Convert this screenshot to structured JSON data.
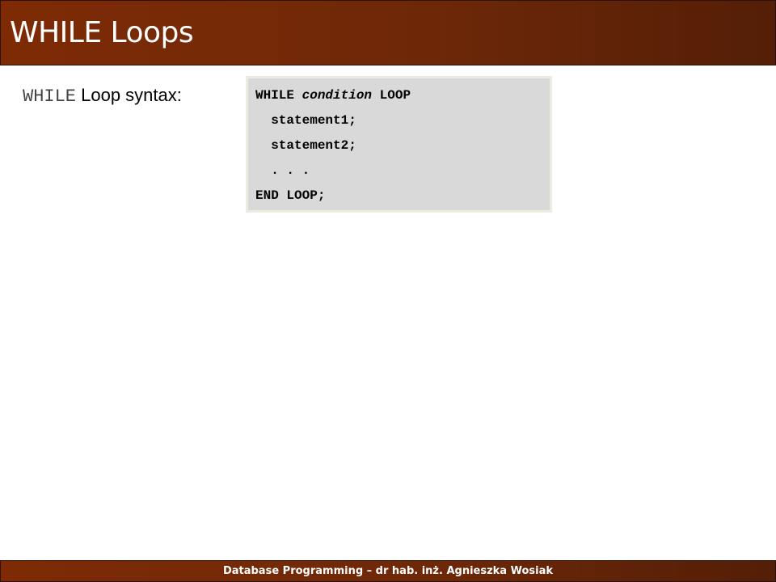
{
  "slide": {
    "title": "WHILE Loops"
  },
  "bullet": {
    "keyword": "WHILE",
    "text": " Loop syntax:"
  },
  "code": {
    "line1_kw1": "WHILE ",
    "line1_cond": "condition",
    "line1_kw2": " LOOP",
    "line2": "  statement1;",
    "line3": "  statement2;",
    "line4": "  . . .",
    "line5": "END LOOP;"
  },
  "footer": {
    "text": "Database Programming – dr hab. inż. Agnieszka Wosiak"
  },
  "colors": {
    "title_bar": "#7e2b05",
    "code_background": "#d9d9d9"
  }
}
